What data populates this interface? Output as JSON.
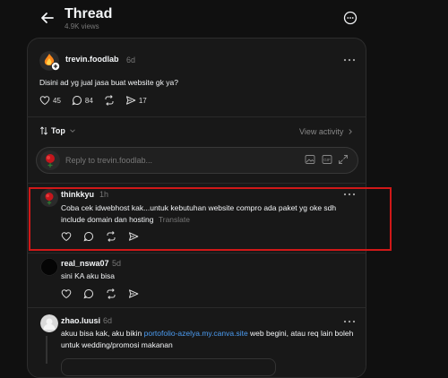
{
  "header": {
    "title": "Thread",
    "views": "4.9K views"
  },
  "post": {
    "username": "trevin.foodlab",
    "time": "6d",
    "text": "Disini ad yg jual jasa buat website gk ya?",
    "likes": "45",
    "comments": "84",
    "shares": "17"
  },
  "sort": {
    "label": "Top",
    "view_activity": "View activity"
  },
  "reply": {
    "placeholder": "Reply to trevin.foodlab..."
  },
  "replies": [
    {
      "username": "thinkkyu",
      "time": "1h",
      "text": "Coba cek idwebhost kak...untuk kebutuhan website compro ada paket yg oke sdh include domain dan hosting",
      "translate": "Translate"
    },
    {
      "username": "real_nswa07",
      "time": "5d",
      "text": "sini KA aku bisa"
    },
    {
      "username": "zhao.luusi",
      "time": "6d",
      "text_before": "akuu bisa kak, aku bikin ",
      "link": "portofolio-azelya.my.canva.site",
      "text_after": " web begini, atau req lain boleh untuk wedding/promosi makanan"
    }
  ]
}
